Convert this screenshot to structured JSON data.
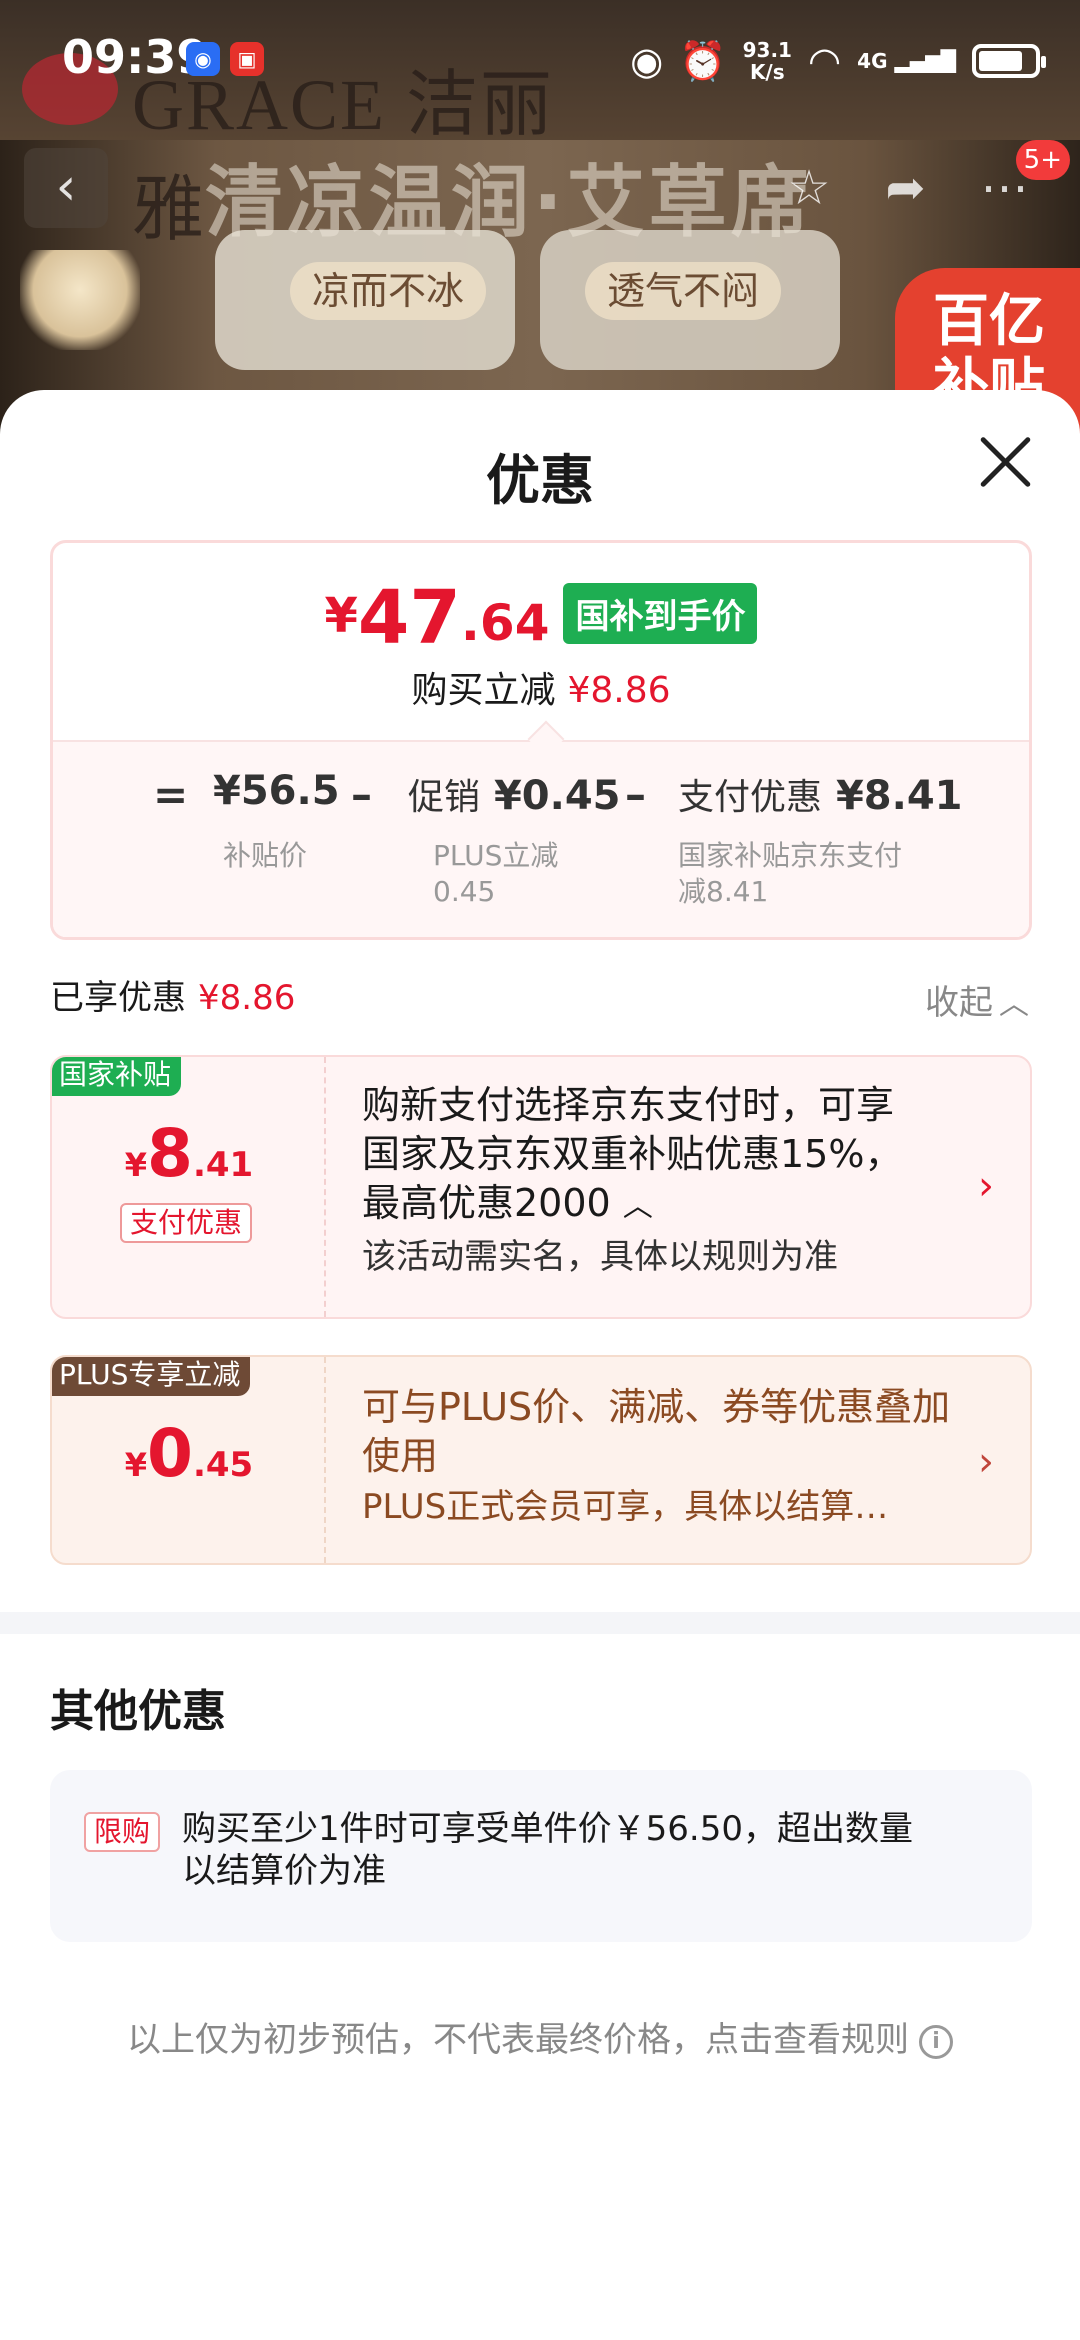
{
  "status_bar": {
    "time": "09:39",
    "net_speed_value": "93.1",
    "net_speed_unit": "K/s",
    "network": "4G",
    "battery_level": 0.8
  },
  "product_banner": {
    "brand": "GRACE 洁丽雅",
    "slogan": "清凉温润·艾草席",
    "chips": [
      "凉而不冰",
      "透气不闷"
    ],
    "subsidy_badge": "百亿补贴",
    "cart_badge": "5+"
  },
  "sheet": {
    "title": "优惠",
    "summary": {
      "final_price_symbol": "¥",
      "final_price_int": "47",
      "final_price_dec": ".64",
      "final_price_tag": "国补到手价",
      "reduce_label": "购买立减",
      "reduce_amount": "¥8.86",
      "formula": {
        "eq": "=",
        "subsidy_price": "¥56.5",
        "subsidy_price_label": "补贴价",
        "minus1": "–",
        "promo_label": "促销",
        "promo_amount": "¥0.45",
        "promo_detail": "PLUS立减0.45",
        "minus2": "–",
        "pay_label": "支付优惠",
        "pay_amount": "¥8.41",
        "pay_detail": "国家补贴京东支付减8.41"
      }
    },
    "enjoyed_label": "已享优惠",
    "enjoyed_amount": "¥8.86",
    "collapse_label": "收起",
    "offers": [
      {
        "badge": "国家补贴",
        "symbol": "¥",
        "amount_int": "8",
        "amount_dec": ".41",
        "chip": "支付优惠",
        "description": "购新支付选择京东支付时，可享国家及京东双重补贴优惠15%，最高优惠2000",
        "note": "该活动需实名，具体以规则为准",
        "accent_color": "#1eae52"
      },
      {
        "badge": "PLUS专享立减",
        "symbol": "¥",
        "amount_int": "0",
        "amount_dec": ".45",
        "description": "可与PLUS价、满减、券等优惠叠加使用",
        "note": "PLUS正式会员可享，具体以结算价为准",
        "accent_color": "#6e4a36"
      }
    ],
    "other_title": "其他优惠",
    "other_offer": {
      "tag": "限购",
      "text": "购买至少1件时可享受单件价￥56.50，超出数量以结算价为准"
    },
    "disclaimer": "以上仅为初步预估，不代表最终价格，点击查看规则"
  },
  "colors": {
    "price_red": "#e4162e",
    "subsidy_green": "#1eae52",
    "plus_brown": "#6e4a36"
  },
  "icons": {
    "back": "back-arrow-icon",
    "favorite": "star-icon",
    "share": "share-icon",
    "more": "more-icon",
    "close": "close-icon",
    "collapse": "chevron-up-icon",
    "offer_arrow": "chevron-right-icon",
    "info": "info-icon"
  }
}
